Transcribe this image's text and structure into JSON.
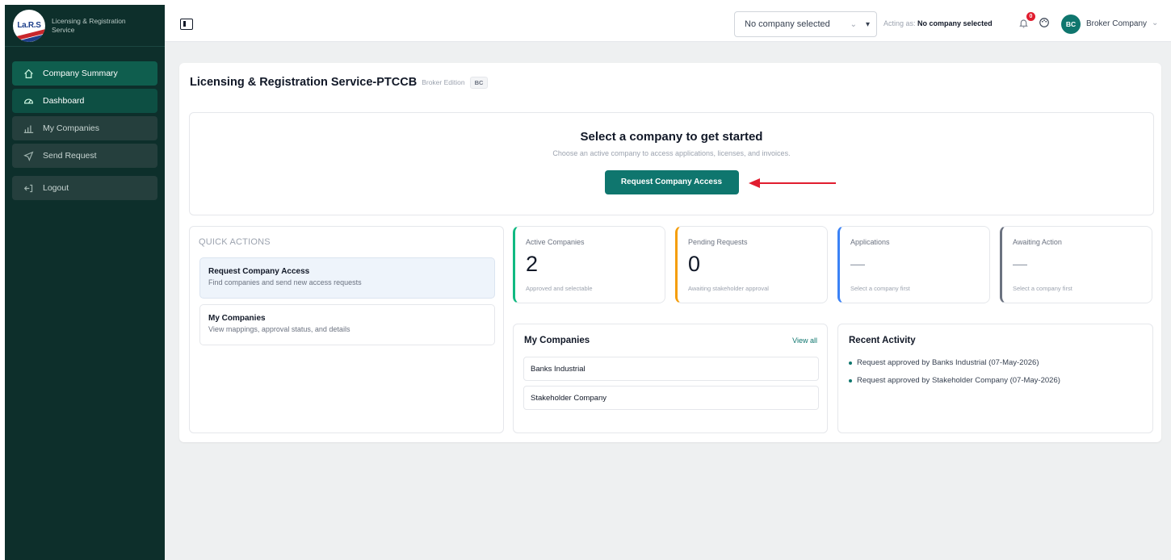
{
  "brand": {
    "logo_text": "La.R.S",
    "name": "Licensing & Registration Service"
  },
  "sidebar": {
    "items": [
      {
        "label": "Company Summary",
        "icon": "home-icon"
      },
      {
        "label": "Dashboard",
        "icon": "dashboard-gauge-icon"
      },
      {
        "label": "My Companies",
        "icon": "bar-chart-icon"
      },
      {
        "label": "Send Request",
        "icon": "send-icon"
      },
      {
        "label": "Logout",
        "icon": "logout-icon"
      }
    ]
  },
  "topbar": {
    "company_select_value": "No company selected",
    "acting_prefix": "Acting as:",
    "acting_value": "No company selected",
    "notification_count": "0",
    "avatar_initials": "BC",
    "user_name": "Broker Company"
  },
  "page": {
    "title": "Licensing & Registration Service-PTCCB",
    "edition": "Broker Edition",
    "badge": "BC"
  },
  "hero": {
    "title": "Select a company to get started",
    "subtitle": "Choose an active company to access applications, licenses, and invoices.",
    "button": "Request Company Access"
  },
  "quick_actions": {
    "title": "QUICK ACTIONS",
    "items": [
      {
        "title": "Request Company Access",
        "subtitle": "Find companies and send new access requests"
      },
      {
        "title": "My Companies",
        "subtitle": "View mappings, approval status, and details"
      }
    ]
  },
  "stats": [
    {
      "label": "Active Companies",
      "value": "2",
      "sub": "Approved and selectable",
      "color": "#10b981"
    },
    {
      "label": "Pending Requests",
      "value": "0",
      "sub": "Awaiting stakeholder approval",
      "color": "#f59e0b"
    },
    {
      "label": "Applications",
      "value": "—",
      "sub": "Select a company first",
      "color": "#3b82f6"
    },
    {
      "label": "Awaiting Action",
      "value": "—",
      "sub": "Select a company first",
      "color": "#6b7280"
    }
  ],
  "my_companies": {
    "title": "My Companies",
    "view_all": "View all",
    "rows": [
      "Banks Industrial",
      "Stakeholder Company"
    ]
  },
  "recent_activity": {
    "title": "Recent Activity",
    "items": [
      "Request approved by Banks Industrial (07-May-2026)",
      "Request approved by Stakeholder Company (07-May-2026)"
    ]
  },
  "colors": {
    "sidebar_bg": "#0d2f2b",
    "accent": "#0f766e",
    "annotation_arrow": "#e11d2f"
  }
}
